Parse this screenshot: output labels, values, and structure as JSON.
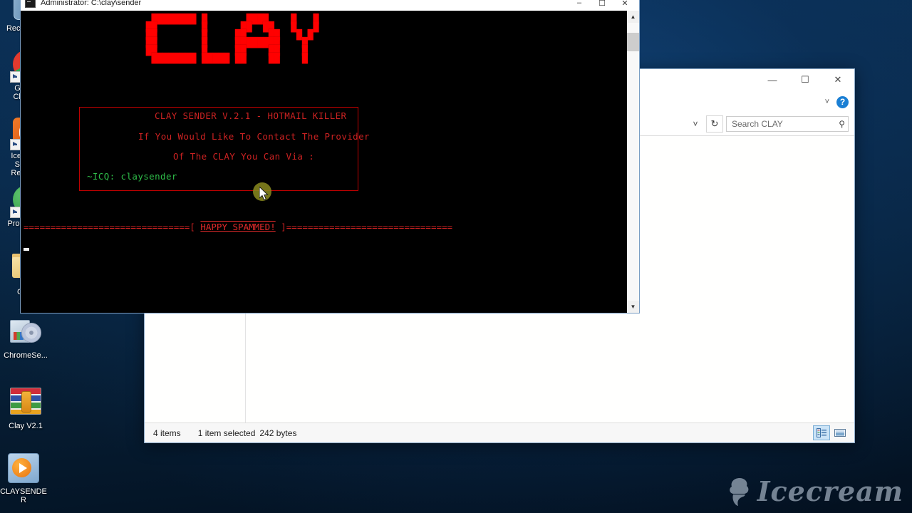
{
  "desktop": {
    "icons": [
      {
        "label": "Recycle Bin",
        "icon": "recycle-bin-icon"
      },
      {
        "label": "Google Chrome",
        "icon": "chrome-icon"
      },
      {
        "label": "Icecream Screen Recorder",
        "icon": "icecream-screen-recorder-icon"
      },
      {
        "label": "ProtonVPN",
        "icon": "protonvpn-icon"
      },
      {
        "label": "CLAY",
        "icon": "folder-icon"
      },
      {
        "label": "ChromeSe...",
        "icon": "cd-setup-icon"
      },
      {
        "label": "Clay V2.1",
        "icon": "winrar-archive-icon"
      },
      {
        "label": "CLAYSENDER",
        "icon": "media-player-icon"
      }
    ]
  },
  "explorer": {
    "window_controls": {
      "minimize": "—",
      "maximize": "☐",
      "close": "✕"
    },
    "ribbon_chevron": "˅",
    "help_label": "?",
    "address_chevron": "˅",
    "refresh_label": "↻",
    "search": {
      "placeholder": "Search CLAY",
      "magnifier": "⚲"
    },
    "status": {
      "items_count": "4 items",
      "selection": "1 item selected",
      "size": "242 bytes"
    },
    "view_buttons": [
      {
        "name": "details-view",
        "active": true
      },
      {
        "name": "large-icons-view",
        "active": false
      }
    ]
  },
  "console": {
    "title": "Administrator: C:\\clay\\sender",
    "titlebar_buttons": {
      "minimize": "–",
      "maximize": "☐",
      "close": "✕"
    },
    "scrollbar": {
      "up": "▲",
      "down": "▼"
    },
    "ascii_logo": [
      "  ████████ █       ████    █   █",
      " ██        █      ██  ██   █   █",
      " ██        █     ██    ██   █ █ ",
      " ██        █     ████████    █  ",
      " ██        █     ██    ██    █  ",
      "  ████████ █████ ██    ██    █  "
    ],
    "lines": {
      "title_line": "CLAY SENDER V.2.1 - HOTMAIL KILLER",
      "contact_line_1": "If You Would Like To Contact The Provider",
      "contact_line_2": "Of The CLAY You Can Via :",
      "icq_line": "~ICQ: claysender"
    },
    "separator": {
      "left": "===============================[ ",
      "banner": "HAPPY SPAMMED!",
      "right": " ]===============================",
      "full_left_count": 31,
      "full_right_count": 31
    }
  },
  "watermark": {
    "text": "Icecream",
    "icon": "ice-cream-cone-icon"
  },
  "colors": {
    "console_red": "#cc2222",
    "console_bright_red": "#ff0000",
    "console_green": "#2fbf4a",
    "desktop_blue": "#0a2b52",
    "accent_blue": "#1a7fd4",
    "click_indicator": "#8a8a1e"
  }
}
